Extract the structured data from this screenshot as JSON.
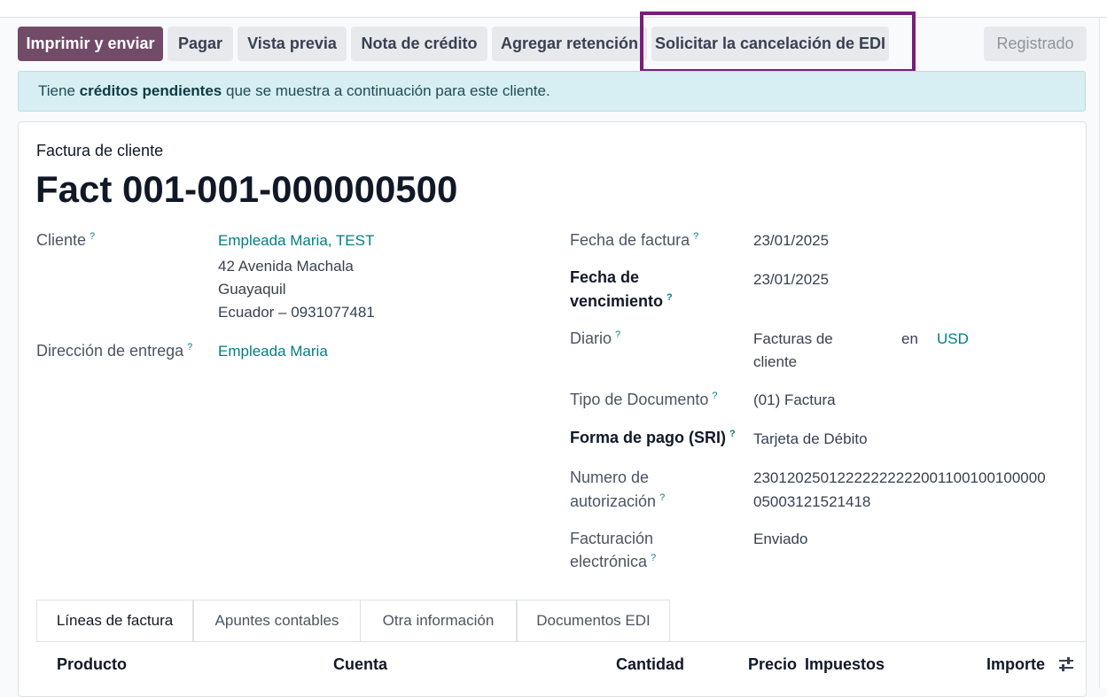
{
  "toolbar": {
    "print_send": "Imprimir y enviar",
    "pay": "Pagar",
    "preview": "Vista previa",
    "credit_note": "Nota de crédito",
    "add_withholding": "Agregar retención",
    "request_edi_cancel": "Solicitar la cancelación de EDI",
    "status": "Registrado"
  },
  "alert": {
    "prefix": "Tiene",
    "bold": "créditos pendientes",
    "suffix": "que se muestra a continuación para este cliente."
  },
  "invoice": {
    "type": "Factura de cliente",
    "number": "Fact 001-001-000000500"
  },
  "fields": {
    "customer_label": "Cliente",
    "customer_name": "Empleada Maria, TEST",
    "address_line1": "42 Avenida Machala",
    "address_line2": "Guayaquil",
    "address_line3": "Ecuador – 0931077481",
    "delivery_label": "Dirección de entrega",
    "delivery_value": "Empleada Maria",
    "invoice_date_label": "Fecha de factura",
    "invoice_date": "23/01/2025",
    "due_date_label_1": "Fecha de",
    "due_date_label_2": "vencimiento",
    "due_date": "23/01/2025",
    "journal_label": "Diario",
    "journal_value_1": "Facturas de",
    "journal_value_2": "cliente",
    "journal_in": "en",
    "currency": "USD",
    "doc_type_label": "Tipo de Documento",
    "doc_type": "(01) Factura",
    "payment_method_label": "Forma de pago (SRI)",
    "payment_method": "Tarjeta de Débito",
    "auth_label_1": "Numero de",
    "auth_label_2": "autorización",
    "auth_number_1": "23012025012222222222001100100100000",
    "auth_number_2": "05003121521418",
    "einvoice_label_1": "Facturación",
    "einvoice_label_2": "electrónica",
    "einvoice_status": "Enviado",
    "help_mark": "?"
  },
  "tabs": [
    "Líneas de factura",
    "Apuntes contables",
    "Otra información",
    "Documentos EDI"
  ],
  "table": {
    "columns": [
      "Producto",
      "Cuenta",
      "Cantidad",
      "Precio",
      "Impuestos",
      "Importe"
    ]
  },
  "colors": {
    "primary": "#714b67",
    "link": "#017e84",
    "highlight": "#7a1d7a",
    "alert_bg": "#d7eef2"
  },
  "icons": {
    "optional_columns": "sliders-icon"
  }
}
